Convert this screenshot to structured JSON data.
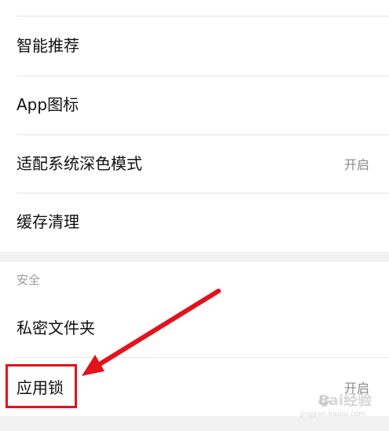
{
  "settings_group_1": {
    "items": [
      {
        "label": "智能推荐",
        "value": ""
      },
      {
        "label": "App图标",
        "value": ""
      },
      {
        "label": "适配系统深色模式",
        "value": "开启"
      },
      {
        "label": "缓存清理",
        "value": ""
      }
    ]
  },
  "security_section": {
    "header": "安全",
    "items": [
      {
        "label": "私密文件夹",
        "value": ""
      },
      {
        "label": "应用锁",
        "value": "开启"
      }
    ]
  },
  "annotation": {
    "box_color": "#e3121b",
    "arrow_color": "#e3121b"
  },
  "watermark": {
    "brand": "Bai经验",
    "sub": "jingyan.baidu.com"
  }
}
